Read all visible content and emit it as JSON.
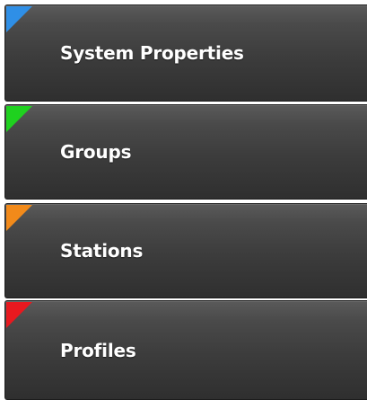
{
  "menu": {
    "items": [
      {
        "label": "System Properties",
        "accent_color": "#2f8fe6"
      },
      {
        "label": "Groups",
        "accent_color": "#1fd11f"
      },
      {
        "label": "Stations",
        "accent_color": "#f28a1a"
      },
      {
        "label": "Profiles",
        "accent_color": "#e8191f"
      }
    ]
  }
}
